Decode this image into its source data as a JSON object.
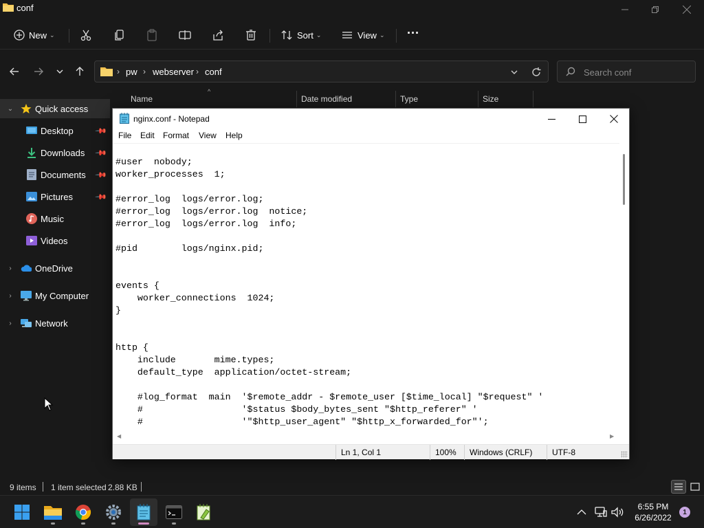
{
  "explorer": {
    "title": "conf",
    "command_bar": {
      "new_label": "New",
      "sort_label": "Sort",
      "view_label": "View",
      "more_label": "···"
    },
    "breadcrumb": [
      "pw",
      "webserver",
      "conf"
    ],
    "search": {
      "placeholder": "Search conf"
    },
    "sidebar": {
      "items": [
        {
          "label": "Quick access",
          "icon": "star-icon",
          "color": "#f5c518"
        },
        {
          "label": "Desktop",
          "icon": "desktop-icon",
          "pinned": true
        },
        {
          "label": "Downloads",
          "icon": "download-icon",
          "pinned": true
        },
        {
          "label": "Documents",
          "icon": "documents-icon",
          "pinned": true
        },
        {
          "label": "Pictures",
          "icon": "pictures-icon",
          "pinned": true
        },
        {
          "label": "Music",
          "icon": "music-icon"
        },
        {
          "label": "Videos",
          "icon": "videos-icon"
        },
        {
          "label": "OneDrive",
          "icon": "cloud-icon"
        },
        {
          "label": "My Computer",
          "icon": "computer-icon"
        },
        {
          "label": "Network",
          "icon": "network-icon"
        }
      ]
    },
    "columns": [
      "Name",
      "Date modified",
      "Type",
      "Size"
    ],
    "status": {
      "item_count": "9 items",
      "selection": "1 item selected",
      "size": "2.88 KB"
    }
  },
  "notepad": {
    "title": "nginx.conf - Notepad",
    "menu": [
      "File",
      "Edit",
      "Format",
      "View",
      "Help"
    ],
    "content": "#user  nobody;\nworker_processes  1;\n\n#error_log  logs/error.log;\n#error_log  logs/error.log  notice;\n#error_log  logs/error.log  info;\n\n#pid        logs/nginx.pid;\n\n\nevents {\n    worker_connections  1024;\n}\n\n\nhttp {\n    include       mime.types;\n    default_type  application/octet-stream;\n\n    #log_format  main  '$remote_addr - $remote_user [$time_local] \"$request\" '\n    #                  '$status $body_bytes_sent \"$http_referer\" '\n    #                  '\"$http_user_agent\" \"$http_x_forwarded_for\"';",
    "status": {
      "position": "Ln 1, Col 1",
      "zoom": "100%",
      "line_ending": "Windows (CRLF)",
      "encoding": "UTF-8"
    }
  },
  "taskbar": {
    "apps": [
      "start-icon",
      "file-explorer-icon",
      "chrome-icon",
      "settings-icon",
      "notepad-icon",
      "terminal-icon",
      "notepadpp-icon"
    ],
    "time": "6:55 PM",
    "date": "6/26/2022",
    "notification_count": "1"
  },
  "colors": {
    "folder": "#f2c14e",
    "accent": "#d08ac0",
    "background": "#191919"
  }
}
